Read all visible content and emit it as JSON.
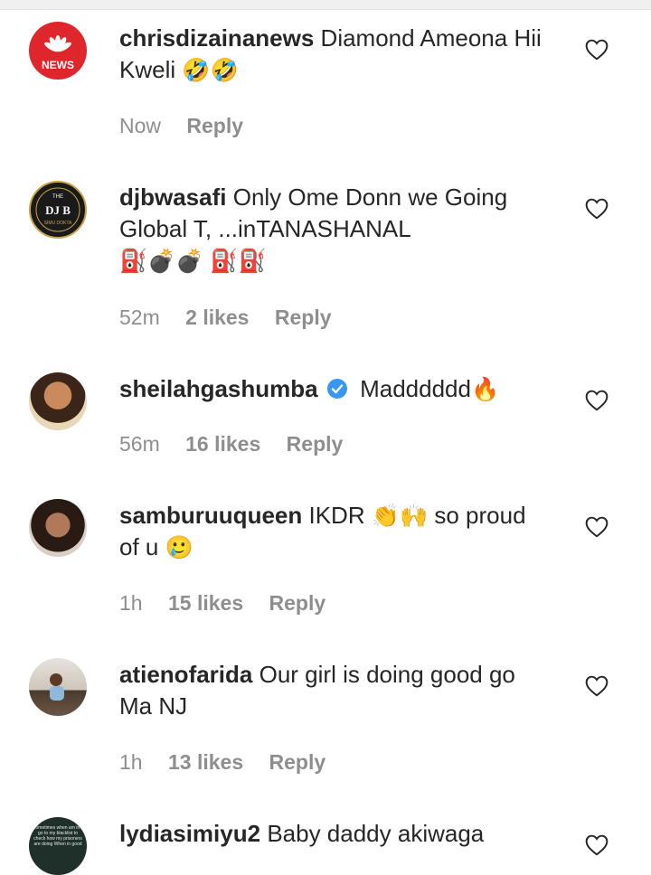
{
  "comments": [
    {
      "username": "chrisdizainanews",
      "text": "Diamond Ameona Hii Kweli",
      "emoji": "🤣🤣",
      "time": "Now",
      "likes": "",
      "reply": "Reply",
      "avatar_text": "NEWS"
    },
    {
      "username": "djbwasafi",
      "text": "Only Ome Donn we Going Global T, ...inTANASHANAL",
      "emoji": "⛽💣💣 ⛽⛽",
      "time": "52m",
      "likes": "2 likes",
      "reply": "Reply",
      "avatar_text": "DJ B",
      "avatar_top": "THE",
      "avatar_bottom": "SIMU DOKTA"
    },
    {
      "username": "sheilahgashumba",
      "text": "Madddddd",
      "emoji": "🔥",
      "time": "56m",
      "likes": "16 likes",
      "reply": "Reply",
      "verified": true
    },
    {
      "username": "samburuuqueen",
      "text": "IKDR",
      "emoji_mid": "👏🙌",
      "text2": "so proud of u",
      "emoji": "🥲",
      "time": "1h",
      "likes": "15 likes",
      "reply": "Reply"
    },
    {
      "username": "atienofarida",
      "text": "Our girl is doing good go Ma NJ",
      "emoji": "",
      "time": "1h",
      "likes": "13 likes",
      "reply": "Reply"
    },
    {
      "username": "lydiasimiyu2",
      "text": "Baby daddy akiwaga",
      "emoji": "",
      "avatar_text": "sometimes when am in I go to my blacklist to check how my prisoners are doing When in good"
    }
  ],
  "colors": {
    "text": "#262626",
    "meta": "#8e8e8e",
    "news_red": "#e0262d",
    "verified": "#3897f0"
  },
  "icons": {
    "heart": "heart-outline-icon"
  }
}
